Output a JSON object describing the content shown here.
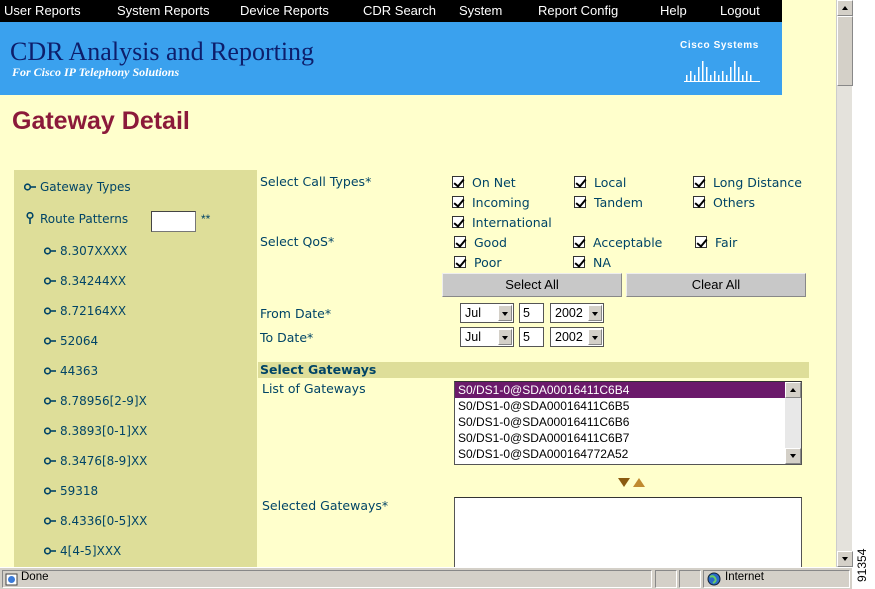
{
  "menu": {
    "items": [
      "User Reports",
      "System Reports",
      "Device Reports",
      "CDR Search",
      "System",
      "Report Config",
      "Help",
      "Logout"
    ]
  },
  "banner": {
    "title": "CDR Analysis and Reporting",
    "subtitle": "For Cisco IP Telephony Solutions",
    "logo_text": "Cisco Systems"
  },
  "page": {
    "title": "Gateway Detail"
  },
  "nav": {
    "gateway_types": "Gateway Types",
    "route_patterns": "Route Patterns",
    "route_patterns_input": "",
    "route_patterns_marker": "**",
    "patterns": [
      "8.307XXXX",
      "8.34244XX",
      "8.72164XX",
      "52064",
      "44363",
      "8.78956[2-9]X",
      "8.3893[0-1]XX",
      "8.3476[8-9]XX",
      "59318",
      "8.4336[0-5]XX",
      "4[4-5]XXX"
    ]
  },
  "form": {
    "call_types_label": "Select Call Types*",
    "call_types": [
      {
        "label": "On Net",
        "checked": true
      },
      {
        "label": "Local",
        "checked": true
      },
      {
        "label": "Long Distance",
        "checked": true
      },
      {
        "label": "Incoming",
        "checked": true
      },
      {
        "label": "Tandem",
        "checked": true
      },
      {
        "label": "Others",
        "checked": true
      },
      {
        "label": "International",
        "checked": true
      }
    ],
    "qos_label": "Select QoS*",
    "qos": [
      {
        "label": "Good",
        "checked": true
      },
      {
        "label": "Acceptable",
        "checked": true
      },
      {
        "label": "Fair",
        "checked": true
      },
      {
        "label": "Poor",
        "checked": true
      },
      {
        "label": "NA",
        "checked": true
      }
    ],
    "select_all": "Select All",
    "clear_all": "Clear All",
    "from_date_label": "From Date*",
    "to_date_label": "To Date*",
    "from_date": {
      "month": "Jul",
      "day": "5",
      "year": "2002"
    },
    "to_date": {
      "month": "Jul",
      "day": "5",
      "year": "2002"
    },
    "gateways_section": "Select Gateways",
    "list_label": "List of Gateways",
    "gateways": [
      "S0/DS1-0@SDA00016411C6B4",
      "S0/DS1-0@SDA00016411C6B5",
      "S0/DS1-0@SDA00016411C6B6",
      "S0/DS1-0@SDA00016411C6B7",
      "S0/DS1-0@SDA000164772A52"
    ],
    "selected_gateway": "S0/DS1-0@SDA00016411C6B4",
    "selected_label": "Selected Gateways*"
  },
  "status": {
    "left": "Done",
    "zone": "Internet"
  },
  "figure_number": "91354",
  "colors": {
    "menubar": "#000000",
    "banner": "#3aa1ee",
    "page_bg": "#ffffcc",
    "nav_bg": "#dede99",
    "title": "#8b1a3a",
    "selection": "#6b1a6b"
  }
}
